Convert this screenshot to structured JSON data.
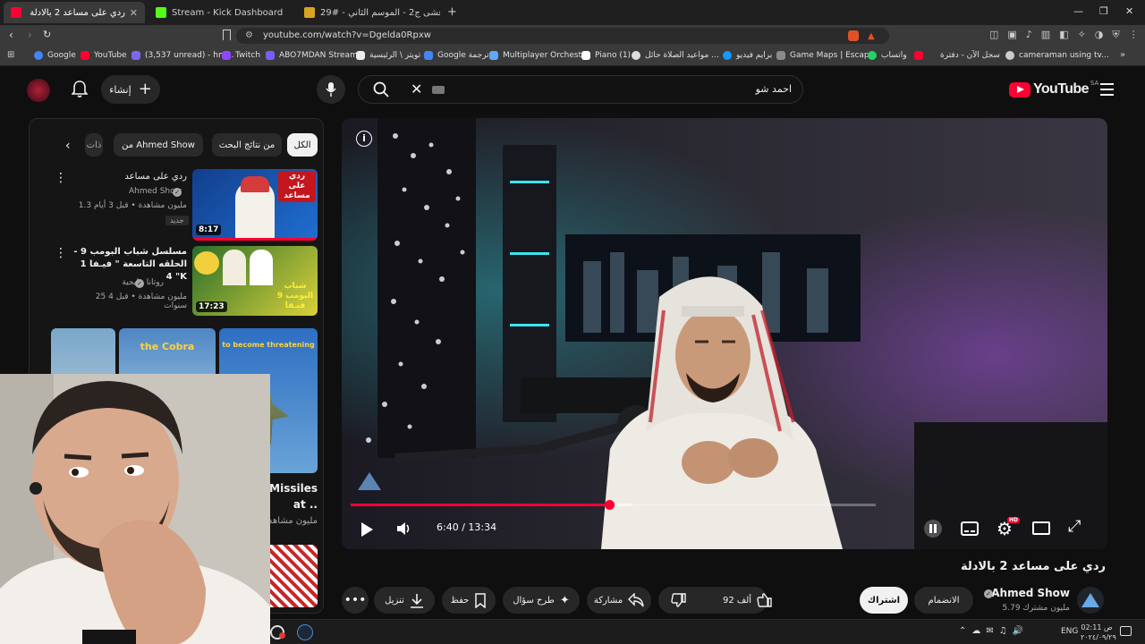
{
  "browser": {
    "tabs": [
      {
        "label": "ردي على مساعد 2 بالادلة - be",
        "active": true
      },
      {
        "label": "Stream - Kick Dashboard",
        "active": false
      },
      {
        "label": "شارع الأعشى ج2 - الموسم الثاني - #29...",
        "active": false
      }
    ],
    "url": "youtube.com/watch?v=Dgelda0Rpxw",
    "bookmarks": [
      "Google",
      "YouTube",
      "(3,537 unread) - hm...",
      "Twitch",
      "ABO7MDAN Stream...",
      "تويتر \\ الرئيسية",
      "Google ترجمة",
      "Multiplayer Orchestra",
      "Piano (1)",
      "مواعيد الصلاة حائل ...",
      "برايم فيديو",
      "Game Maps | Escap...",
      "واتساب",
      "سجل الآن - دفترة",
      "cameraman using tv..."
    ]
  },
  "youtube": {
    "logo": "YouTube",
    "region": "SA",
    "search_query": "احمد شو",
    "create_label": "إنشاء"
  },
  "sidebar": {
    "chips": [
      "الكل",
      "من نتائج البحث",
      "من Ahmed Show",
      "ذات"
    ],
    "videos": [
      {
        "title": "ردي على مساعد",
        "channel": "Ahmed Show",
        "meta": "1.3 مليون مشاهدة • قبل 3 أيام",
        "badge": "جديد",
        "duration": "8:17",
        "thumb_text": "ردي على مساعد"
      },
      {
        "title": "مسلسل شباب البومب 9 - الحلقه التاسعة \" فيـفا 1 \" 4K",
        "channel": "روتانا خليجية",
        "meta": "25 مليون مشاهدة • قبل 4 سنوات",
        "duration": "17:23",
        "thumb_text": "شباب البومب 9 فيـفا"
      }
    ],
    "shorts": [
      {
        "caption": "the Cobra"
      },
      {
        "caption": "to become threatening"
      }
    ],
    "shorts_title": "Firing Missiles at ..",
    "shorts_meta": "4.2 مليون مشاهدة"
  },
  "player": {
    "time": "6:40 / 13:34",
    "progress_fraction": 0.492
  },
  "video": {
    "title": "ردي على مساعد 2 بالادلة",
    "channel": "Ahmed Show",
    "subscribers": "5.79 مليون مشترك",
    "join_label": "الانضمام",
    "subscribe_label": "اشتراك",
    "likes": "92 ألف",
    "share_label": "مشاركة",
    "ask_label": "طرح سؤال",
    "save_label": "حفظ",
    "download_label": "تنزيل"
  },
  "taskbar": {
    "lang": "ENG",
    "time": "02:11 ص",
    "date": "٢٠٢٤/٠٩/٢٩"
  },
  "colors": {
    "accent": "#ff0033",
    "bg": "#0f0f0f"
  }
}
